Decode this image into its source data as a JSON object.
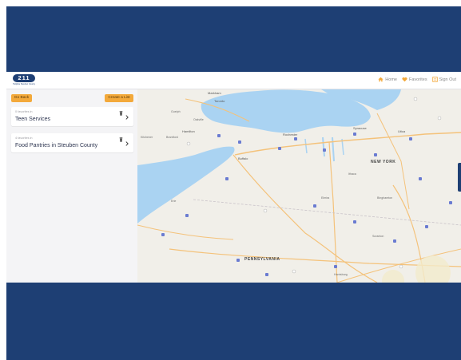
{
  "brand": {
    "logo_text": "211",
    "tagline": "Helpline Steuben County"
  },
  "nav": [
    {
      "label": "Home",
      "icon": "home-icon",
      "color": "#f3a93b"
    },
    {
      "label": "Favorites",
      "icon": "heart-icon",
      "color": "#f3a93b"
    },
    {
      "label": "Sign Out",
      "icon": "sign-out-icon",
      "color": "#f3a93b"
    }
  ],
  "sidebar": {
    "go_back_label": "Go Back",
    "create_list_label": "Create a List",
    "lists": [
      {
        "meta": "0 favorites in",
        "title": "Teen Services"
      },
      {
        "meta": "4 favorites in",
        "title": "Food Pantries in Steuben County"
      }
    ]
  },
  "map": {
    "labels": {
      "markham": "Markham",
      "toronto": "Toronto",
      "guelph": "Guelph",
      "oakville": "Oakville",
      "hamilton": "Hamilton",
      "brantford": "Brantford",
      "kitchener": "Kitchener",
      "rochester": "Rochester",
      "syracuse": "Syracuse",
      "utica": "Utica",
      "buffalo": "Buffalo",
      "ithaca": "Ithaca",
      "elmira": "Elmira",
      "binghamton": "Binghamton",
      "erie": "Erie",
      "scranton": "Scranton",
      "harrisburg": "Harrisburg",
      "state_ny": "NEW YORK",
      "state_pa": "PENNSYLVANIA"
    }
  },
  "colors": {
    "brand": "#1e3f74",
    "accent": "#f3a93b",
    "water": "#aad3f2",
    "land": "#f1efe9"
  }
}
